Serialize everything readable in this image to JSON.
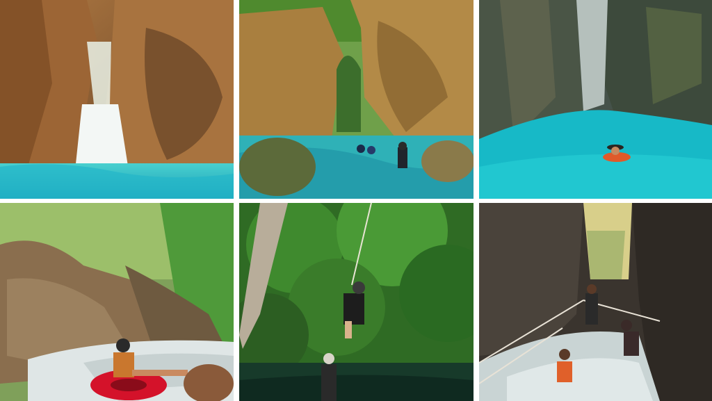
{
  "collage": {
    "photos": [
      {
        "scene": "canyon-waterfall-turquoise-pool"
      },
      {
        "scene": "river-canyon-swimmers-rock-arch"
      },
      {
        "scene": "turquoise-canyon-swimmer-waterfall"
      },
      {
        "scene": "river-tubing-rocky-stream"
      },
      {
        "scene": "rope-swing-forest-river"
      },
      {
        "scene": "canyon-rope-walk-rushing-water"
      }
    ],
    "colors": {
      "water": "#1fb3c4",
      "rock": "#8a5a33",
      "foliage": "#3f7a2a",
      "tube": "#d4122a"
    }
  }
}
